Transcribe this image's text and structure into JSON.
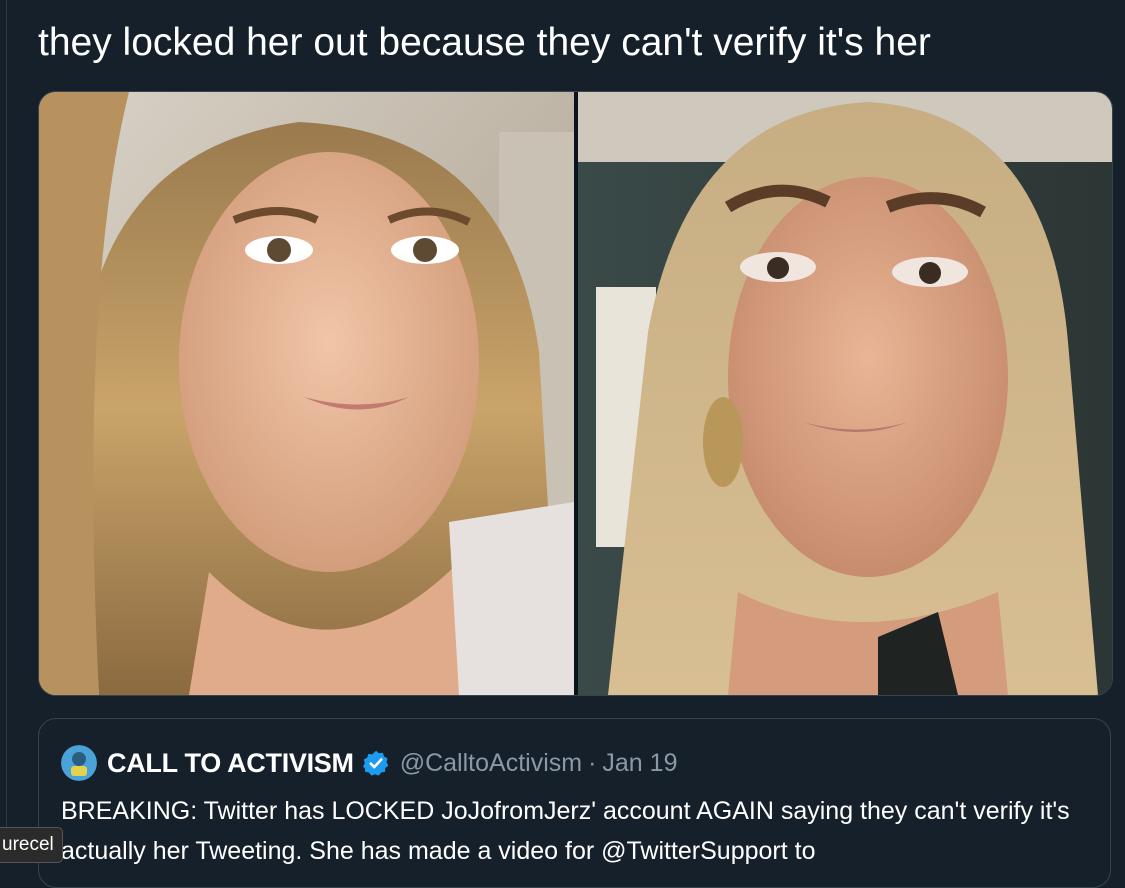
{
  "tweet": {
    "text": "they locked her out because they can't verify it's her"
  },
  "media": {
    "images": [
      {
        "icon": "portrait-photo-left",
        "description_visible": false
      },
      {
        "icon": "portrait-photo-right",
        "description_visible": false
      }
    ],
    "colors": {
      "border": "#38444d",
      "background": "#15202b"
    }
  },
  "quoted_tweet": {
    "author_name": "CALL TO ACTIVISM",
    "verified_icon": "verified-badge-icon",
    "handle": "@CalltoActivism",
    "separator": "·",
    "date": "Jan 19",
    "body": "BREAKING: Twitter has LOCKED JoJofromJerz' account AGAIN saying they can't verify it's actually her Tweeting. She has made a video for @TwitterSupport to"
  },
  "tooltip": {
    "text": "urecel"
  },
  "colors": {
    "text": "#ffffff",
    "muted": "#8b98a5",
    "verified": "#1d9bf0"
  }
}
